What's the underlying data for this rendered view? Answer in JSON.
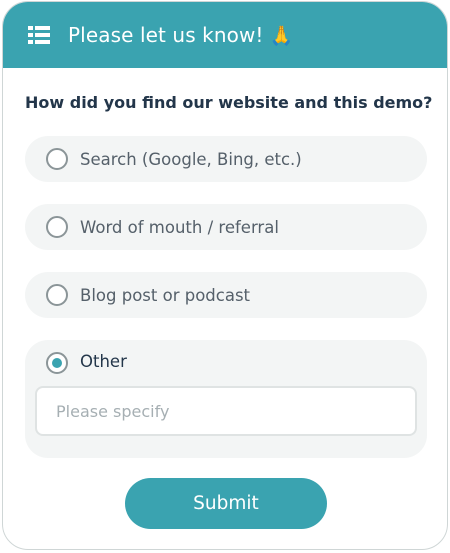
{
  "header": {
    "title": "Please let us know!",
    "emoji": "🙏",
    "icon": "list-icon",
    "background_color": "#3aa3b0"
  },
  "question": "How did you find our website and this demo?",
  "options": [
    {
      "label": "Search (Google, Bing, etc.)",
      "selected": false
    },
    {
      "label": "Word of mouth / referral",
      "selected": false
    },
    {
      "label": "Blog post or podcast",
      "selected": false
    },
    {
      "label": "Other",
      "selected": true
    }
  ],
  "specify": {
    "value": "",
    "placeholder": "Please specify"
  },
  "submit_label": "Submit",
  "accent_color": "#3aa3b0"
}
